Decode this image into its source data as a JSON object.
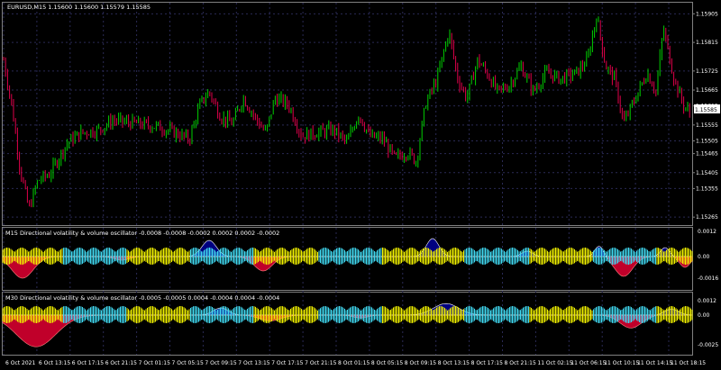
{
  "main": {
    "header": "EURUSD,M15  1.15600 1.15600 1.15579 1.15585",
    "current_price": "1.15585",
    "price_labels": [
      "1.15905",
      "1.15815",
      "1.15725",
      "1.15665",
      "1.15615",
      "1.15555",
      "1.15505",
      "1.15465",
      "1.15405",
      "1.15355",
      "1.15265"
    ],
    "price_values": [
      1.15905,
      1.15815,
      1.15725,
      1.15665,
      1.15615,
      1.15555,
      1.15505,
      1.15465,
      1.15405,
      1.15355,
      1.15265
    ]
  },
  "panel1": {
    "header": "M15 Directional volatility & volume oscillator -0.0008 -0.0008 -0.0002 0.0002 0.0002 -0.0002",
    "axis_labels": [
      "0.0012",
      "0.00",
      "-0.0016"
    ]
  },
  "panel2": {
    "header": "M30 Directional volatility & volume oscillator -0.0005 -0.0005 0.0004 -0.0004 0.0004 -0.0004",
    "axis_labels": [
      "0.0012",
      "0.00",
      "-0.0025"
    ]
  },
  "time_axis": [
    "6 Oct 2021",
    "6 Oct 13:15",
    "6 Oct 17:15",
    "6 Oct 21:15",
    "7 Oct 01:15",
    "7 Oct 05:15",
    "7 Oct 09:15",
    "7 Oct 13:15",
    "7 Oct 17:15",
    "7 Oct 21:15",
    "8 Oct 01:15",
    "8 Oct 05:15",
    "8 Oct 09:15",
    "8 Oct 13:15",
    "8 Oct 17:15",
    "8 Oct 21:15",
    "11 Oct 02:15",
    "11 Oct 06:15",
    "11 Oct 10:15",
    "11 Oct 14:15",
    "11 Oct 18:15"
  ],
  "colors": {
    "bull": "#00d000",
    "bear": "#e0004a",
    "grid": "#2a2a55",
    "pos_fill": "#000080",
    "neg_fill": "#c0002a",
    "bar_yellow": "#f0f000",
    "bar_cyan": "#40d8f0"
  }
}
